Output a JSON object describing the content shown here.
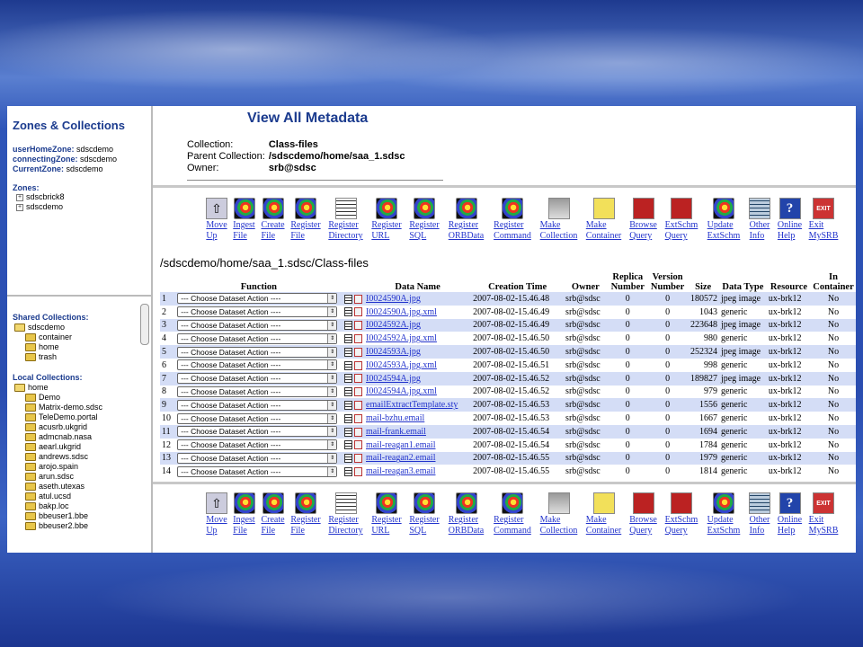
{
  "left": {
    "title": "Zones & Collections",
    "user_home_zone_label": "userHomeZone:",
    "user_home_zone": "sdscdemo",
    "connecting_zone_label": "connectingZone:",
    "connecting_zone": "sdscdemo",
    "current_zone_label": "CurrentZone:",
    "current_zone": "sdscdemo",
    "zones_label": "Zones:",
    "zones": [
      "sdscbrick8",
      "sdscdemo"
    ],
    "shared_label": "Shared Collections:",
    "shared_root": "sdscdemo",
    "shared_children": [
      "container",
      "home",
      "trash"
    ],
    "local_label": "Local Collections:",
    "local_root": "home",
    "local_children": [
      "Demo",
      "Matrix-demo.sdsc",
      "TeleDemo.portal",
      "acusrb.ukgrid",
      "admcnab.nasa",
      "aearl.ukgrid",
      "andrews.sdsc",
      "arojo.spain",
      "arun.sdsc",
      "aseth.utexas",
      "atul.ucsd",
      "bakp.loc",
      "bbeuser1.bbe",
      "bbeuser2.bbe"
    ]
  },
  "main": {
    "title": "View All Metadata",
    "collection_label": "Collection:",
    "collection": "Class-files",
    "parent_label": "Parent Collection:",
    "parent": "/sdscdemo/home/saa_1.sdsc",
    "owner_label": "Owner:",
    "owner": "srb@sdsc",
    "path": "/sdscdemo/home/saa_1.sdsc/Class-files"
  },
  "toolbar": [
    {
      "label": "Move\nUp",
      "icon": "up-arrow-icon"
    },
    {
      "label": "Ingest\nFile",
      "icon": "swirl-icon"
    },
    {
      "label": "Create\nFile",
      "icon": "swirl-icon"
    },
    {
      "label": "Register\nFile",
      "icon": "swirl-icon"
    },
    {
      "label": "Register\nDirectory",
      "icon": "document-icon"
    },
    {
      "label": "Register\nURL",
      "icon": "swirl-icon"
    },
    {
      "label": "Register\nSQL",
      "icon": "swirl-icon"
    },
    {
      "label": "Register\nORBData",
      "icon": "swirl-icon"
    },
    {
      "label": "Register\nCommand",
      "icon": "swirl-icon"
    },
    {
      "label": "Make\nCollection",
      "icon": "computer-icon"
    },
    {
      "label": "Make\nContainer",
      "icon": "container-box-icon"
    },
    {
      "label": "Browse\nQuery",
      "icon": "browse-query-icon"
    },
    {
      "label": "ExtSchm\nQuery",
      "icon": "browse-query-icon"
    },
    {
      "label": "Update\nExtSchm",
      "icon": "swirl-icon"
    },
    {
      "label": "Other\nInfo",
      "icon": "notes-icon"
    },
    {
      "label": "Online\nHelp",
      "icon": "help-icon"
    },
    {
      "label": "Exit\nMySRB",
      "icon": "exit-icon"
    }
  ],
  "exit_icon_text": "EXIT",
  "help_icon_text": "?",
  "columns": [
    "Function",
    "Data Name",
    "Creation Time",
    "Owner",
    "Replica Number",
    "Version Number",
    "Size",
    "Data Type",
    "Resource",
    "In Container"
  ],
  "select_default": "--- Choose Dataset Action ----",
  "rows": [
    {
      "n": "1",
      "name": "I0024590A.jpg",
      "time": "2007-08-02-15.46.48",
      "owner": "srb@sdsc",
      "rep": "0",
      "ver": "0",
      "size": "180572",
      "type": "jpeg image",
      "res": "ux-brk12",
      "cont": "No"
    },
    {
      "n": "2",
      "name": "I0024590A.jpg.xml",
      "time": "2007-08-02-15.46.49",
      "owner": "srb@sdsc",
      "rep": "0",
      "ver": "0",
      "size": "1043",
      "type": "generic",
      "res": "ux-brk12",
      "cont": "No"
    },
    {
      "n": "3",
      "name": "I0024592A.jpg",
      "time": "2007-08-02-15.46.49",
      "owner": "srb@sdsc",
      "rep": "0",
      "ver": "0",
      "size": "223648",
      "type": "jpeg image",
      "res": "ux-brk12",
      "cont": "No"
    },
    {
      "n": "4",
      "name": "I0024592A.jpg.xml",
      "time": "2007-08-02-15.46.50",
      "owner": "srb@sdsc",
      "rep": "0",
      "ver": "0",
      "size": "980",
      "type": "generic",
      "res": "ux-brk12",
      "cont": "No"
    },
    {
      "n": "5",
      "name": "I0024593A.jpg",
      "time": "2007-08-02-15.46.50",
      "owner": "srb@sdsc",
      "rep": "0",
      "ver": "0",
      "size": "252324",
      "type": "jpeg image",
      "res": "ux-brk12",
      "cont": "No"
    },
    {
      "n": "6",
      "name": "I0024593A.jpg.xml",
      "time": "2007-08-02-15.46.51",
      "owner": "srb@sdsc",
      "rep": "0",
      "ver": "0",
      "size": "998",
      "type": "generic",
      "res": "ux-brk12",
      "cont": "No"
    },
    {
      "n": "7",
      "name": "I0024594A.jpg",
      "time": "2007-08-02-15.46.52",
      "owner": "srb@sdsc",
      "rep": "0",
      "ver": "0",
      "size": "189827",
      "type": "jpeg image",
      "res": "ux-brk12",
      "cont": "No"
    },
    {
      "n": "8",
      "name": "I0024594A.jpg.xml",
      "time": "2007-08-02-15.46.52",
      "owner": "srb@sdsc",
      "rep": "0",
      "ver": "0",
      "size": "979",
      "type": "generic",
      "res": "ux-brk12",
      "cont": "No"
    },
    {
      "n": "9",
      "name": "emailExtractTemplate.sty",
      "time": "2007-08-02-15.46.53",
      "owner": "srb@sdsc",
      "rep": "0",
      "ver": "0",
      "size": "1556",
      "type": "generic",
      "res": "ux-brk12",
      "cont": "No"
    },
    {
      "n": "10",
      "name": "mail-bzhu.email",
      "time": "2007-08-02-15.46.53",
      "owner": "srb@sdsc",
      "rep": "0",
      "ver": "0",
      "size": "1667",
      "type": "generic",
      "res": "ux-brk12",
      "cont": "No"
    },
    {
      "n": "11",
      "name": "mail-frank.email",
      "time": "2007-08-02-15.46.54",
      "owner": "srb@sdsc",
      "rep": "0",
      "ver": "0",
      "size": "1694",
      "type": "generic",
      "res": "ux-brk12",
      "cont": "No"
    },
    {
      "n": "12",
      "name": "mail-reagan1.email",
      "time": "2007-08-02-15.46.54",
      "owner": "srb@sdsc",
      "rep": "0",
      "ver": "0",
      "size": "1784",
      "type": "generic",
      "res": "ux-brk12",
      "cont": "No"
    },
    {
      "n": "13",
      "name": "mail-reagan2.email",
      "time": "2007-08-02-15.46.55",
      "owner": "srb@sdsc",
      "rep": "0",
      "ver": "0",
      "size": "1979",
      "type": "generic",
      "res": "ux-brk12",
      "cont": "No"
    },
    {
      "n": "14",
      "name": "mail-reagan3.email",
      "time": "2007-08-02-15.46.55",
      "owner": "srb@sdsc",
      "rep": "0",
      "ver": "0",
      "size": "1814",
      "type": "generic",
      "res": "ux-brk12",
      "cont": "No"
    }
  ],
  "colors": {
    "row_stripe": "#d4ddf6",
    "link": "#2233cc",
    "title": "#1b3b8e"
  }
}
